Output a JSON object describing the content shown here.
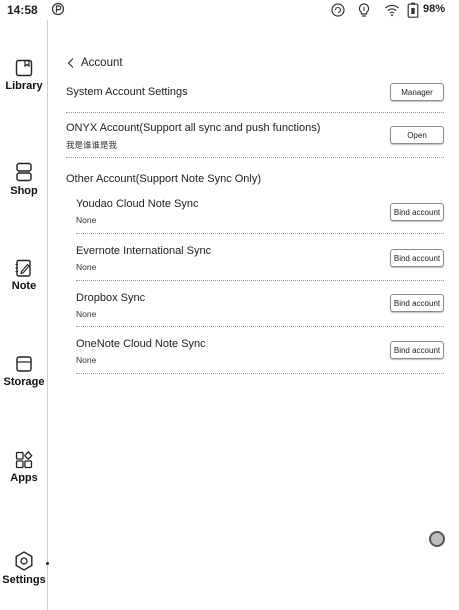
{
  "statusbar": {
    "time": "14:58",
    "battery": "98%",
    "icons": [
      "p-app-icon",
      "sync-icon",
      "lightbulb-icon",
      "wifi-icon",
      "battery-icon"
    ]
  },
  "sidebar": {
    "items": [
      {
        "label": "Library",
        "icon": "library-icon"
      },
      {
        "label": "Shop",
        "icon": "shop-icon"
      },
      {
        "label": "Note",
        "icon": "note-icon"
      },
      {
        "label": "Storage",
        "icon": "storage-icon"
      },
      {
        "label": "Apps",
        "icon": "apps-icon"
      },
      {
        "label": "Settings",
        "icon": "settings-icon"
      }
    ]
  },
  "header": {
    "title": "Account"
  },
  "system_account": {
    "label": "System Account Settings",
    "button": "Manager"
  },
  "onyx_account": {
    "label": "ONYX Account(Support all sync and push functions)",
    "sub": "我是谁谁是我",
    "button": "Open"
  },
  "other_account": {
    "label": "Other Account(Support Note Sync Only)",
    "services": [
      {
        "name": "Youdao Cloud Note Sync",
        "status": "None",
        "button": "Bind account"
      },
      {
        "name": "Evernote International Sync",
        "status": "None",
        "button": "Bind account"
      },
      {
        "name": "Dropbox Sync",
        "status": "None",
        "button": "Bind account"
      },
      {
        "name": "OneNote Cloud Note Sync",
        "status": "None",
        "button": "Bind account"
      }
    ]
  }
}
